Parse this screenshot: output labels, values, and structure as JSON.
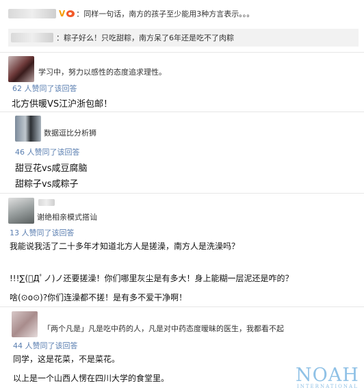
{
  "top_comment": {
    "text": "：同样一句话，南方的孩子至少能用3种方言表示。。。"
  },
  "quoted_reply": {
    "text": "：粽子好么！只吃甜粽，南方呆了6年还是吃不了肉粽"
  },
  "answers": [
    {
      "username": "学习中，努力以感性的态度追求理性。",
      "likes": "62 人赞同了该回答",
      "lines": [
        "北方供暖VS江沪浙包邮！"
      ]
    },
    {
      "username": "数据逗比分析狮",
      "likes": "46 人赞同了该回答",
      "lines": [
        "甜豆花vs咸豆腐脑",
        "甜粽子vs咸粽子"
      ]
    },
    {
      "username": "谢绝相亲模式搭讪",
      "likes": "13 人赞同了该回答",
      "lines": [
        "我能说我活了二十多年才知道北方人是搓澡，南方人是洗澡吗？",
        "!!!∑(ﾟДﾟノ)ノ还要搓澡！你们哪里灰尘是有多大！身上能糊一层泥还是咋的？",
        "啥(⊙o⊙)?你们连澡都不搓！是有多不爱干净啊！"
      ]
    },
    {
      "username": "「两个凡是」凡是吃中药的人，凡是对中药态度暧昧的医生，我都看不起",
      "likes": "44 人赞同了该回答",
      "lines": [
        "同学，这是花菜，不是菜花。",
        "以上是一个山西人愣在四川大学的食堂里。"
      ]
    }
  ],
  "watermark": {
    "word": "NOAH",
    "sub": "INTERNATIONAL"
  },
  "colors": {
    "likes": "#5b7fb1",
    "quote_bg": "#f2f2f2",
    "watermark": "#8fc1e6"
  }
}
